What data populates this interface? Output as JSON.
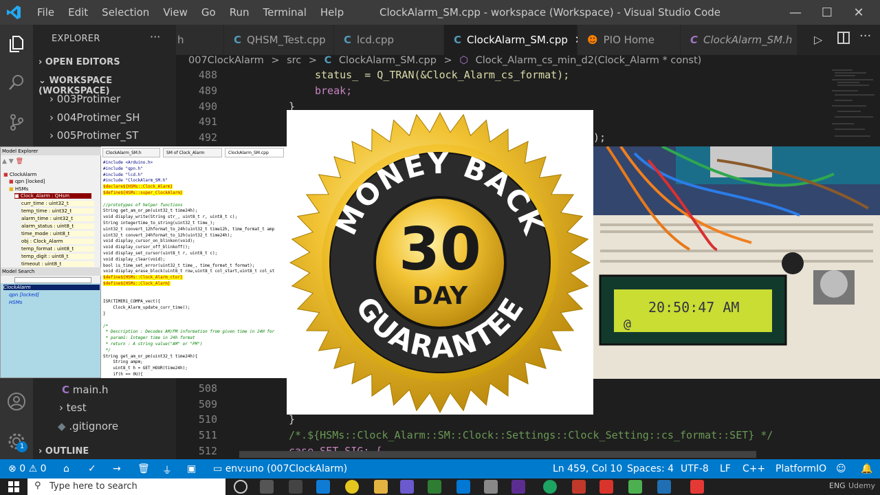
{
  "window": {
    "menu": [
      "File",
      "Edit",
      "Selection",
      "View",
      "Go",
      "Run",
      "Terminal",
      "Help"
    ],
    "title": "ClockAlarm_SM.cpp - workspace (Workspace) - Visual Studio Code",
    "controls": [
      "—",
      "☐",
      "✕"
    ]
  },
  "sidebar": {
    "explorer_label": "EXPLORER",
    "more": "···",
    "open_editors": "OPEN EDITORS",
    "workspace": "WORKSPACE (WORKSPACE)",
    "folders": [
      "003Protimer",
      "004Protimer_SH",
      "005Protimer_ST"
    ],
    "lower_items": [
      {
        "icon": "C",
        "label": "main.h"
      },
      {
        "icon": "",
        "label": "test"
      },
      {
        "icon": "",
        "label": ".gitignore"
      }
    ],
    "outline": "OUTLINE"
  },
  "tabs": [
    {
      "icon": "",
      "label": "h",
      "active": false,
      "italic": false
    },
    {
      "icon": "C",
      "label": "QHSM_Test.cpp",
      "active": false,
      "italic": false
    },
    {
      "icon": "C",
      "label": "lcd.cpp",
      "active": false,
      "italic": false
    },
    {
      "icon": "C",
      "label": "ClockAlarm_SM.cpp",
      "active": true,
      "italic": false,
      "close": "✕"
    },
    {
      "icon": "",
      "label": "PIO Home",
      "active": false,
      "italic": false
    },
    {
      "icon": "C",
      "label": "ClockAlarm_SM.h",
      "active": false,
      "italic": true
    }
  ],
  "breadcrumb": {
    "parts": [
      "007ClockAlarm",
      ">",
      "src",
      ">",
      "ClockAlarm_SM.cpp",
      ">",
      "Clock_Alarm_cs_min_d2(Clock_Alarm * const)"
    ]
  },
  "editor": {
    "top_lines": [
      {
        "num": "488",
        "code": "status_ = Q_TRAN(&Clock_Alarm_cs_format);"
      },
      {
        "num": "489",
        "code": "break;"
      },
      {
        "num": "490",
        "code": "}"
      },
      {
        "num": "491",
        "code": ""
      },
      {
        "num": "492",
        "code": ");"
      }
    ],
    "bottom_lines": [
      {
        "num": "508",
        "code": ""
      },
      {
        "num": "509",
        "code": ""
      },
      {
        "num": "510",
        "code": "}"
      },
      {
        "num": "511",
        "code": "/*.${HSMs::Clock_Alarm::SM::Clock::Settings::Clock_Setting::cs_format::SET} */"
      },
      {
        "num": "512",
        "code": "case SET_SIG: {"
      }
    ]
  },
  "statusbar": {
    "problems": "0",
    "warnings": "0",
    "env": "env:uno (007ClockAlarm)",
    "position": "Ln 459, Col 10",
    "spaces": "Spaces: 4",
    "encoding": "UTF-8",
    "eol": "LF",
    "language": "C++",
    "platform": "PlatformIO",
    "notif_count": "1"
  },
  "taskbar": {
    "search_placeholder": "Type here to search",
    "lang": "ENG",
    "watermark": "Udemy"
  },
  "model_explorer": {
    "title": "Model Explorer",
    "tree": [
      "ClockAlarm",
      "qpn [locked]",
      "HSMs",
      "Clock_Alarm : QHsm",
      "curr_time : uint32_t",
      "temp_time : uint32_t",
      "alarm_time : uint32_t",
      "alarm_status : uint8_t",
      "time_mode : uint8_t",
      "obj : Clock_Alarm",
      "temp_format : uint8_t",
      "temp_digit : uint8_t",
      "timeout : uint8_t"
    ],
    "search_title": "Model Search",
    "search_tree": [
      "ClockAlarm",
      "qpn [locked]",
      "HSMs"
    ]
  },
  "qm_code": {
    "tabs": [
      "ClockAlarm_SM.h",
      "SM of Clock_Alarm",
      "ClockAlarm_SM.cpp"
    ],
    "lines": [
      "#include <Arduino.h>",
      "#include \"qpn.h\"",
      "#include \"lcd.h\"",
      "#include \"ClockAlarm_SM.h\"",
      "$declare${HSMs::Clock_Alarm}",
      "$define${HSMs::super_ClockAlarm}",
      "",
      "//prototypes of helper functions",
      "String get_am_or_pm(uint32_t time24h);",
      "void display_write(String str_, uint8_t r, uint8_t c);",
      "String integertime_to_string(uint32_t time_);",
      "uint32_t convert_12hformat_to_24h(uint32_t time12h, time_format_t amp",
      "uint32_t convert_24hformat_to_12h(uint32_t time24h);",
      "void display_cursor_on_blinkon(void);",
      "void display_cursor_off_blinkoff();",
      "void display_set_cursor(uint8_t r, uint8_t c);",
      "void display_clear(void);",
      "bool is_time_set_error(uint32_t time_, time_format_t format);",
      "void display_erase_block(uint8_t row,uint8_t col_start,uint8_t col_st",
      "$define${HSMs::Clock_Alarm_ctor}",
      "$define${HSMs::Clock_Alarm}",
      "",
      "",
      "ISR(TIMER1_COMPA_vect){",
      "    Clock_Alarm_update_curr_time();",
      "}",
      "",
      "/*",
      " * Description : Decodes AM/PM information from given time in 24H for",
      " * param1: Integer time in 24h format",
      " * return : A string value(\"AM\" or \"PM\")",
      " */",
      "String get_am_or_pm(uint32_t time24h){",
      "    String ampm;",
      "    uint8_t h = GET_HOUR(time24h);",
      "    if(h == 0U){"
    ]
  },
  "badge": {
    "top": "MONEY BACK",
    "number": "30",
    "day": "DAY",
    "bottom": "GUARANTEE"
  },
  "photo": {
    "lcd_time": "20:50:47 AM",
    "lcd_icon": "@"
  },
  "colors": {
    "status_blue": "#007acc",
    "gold": "#e8b21a",
    "badge_dark": "#2b2b2b"
  }
}
